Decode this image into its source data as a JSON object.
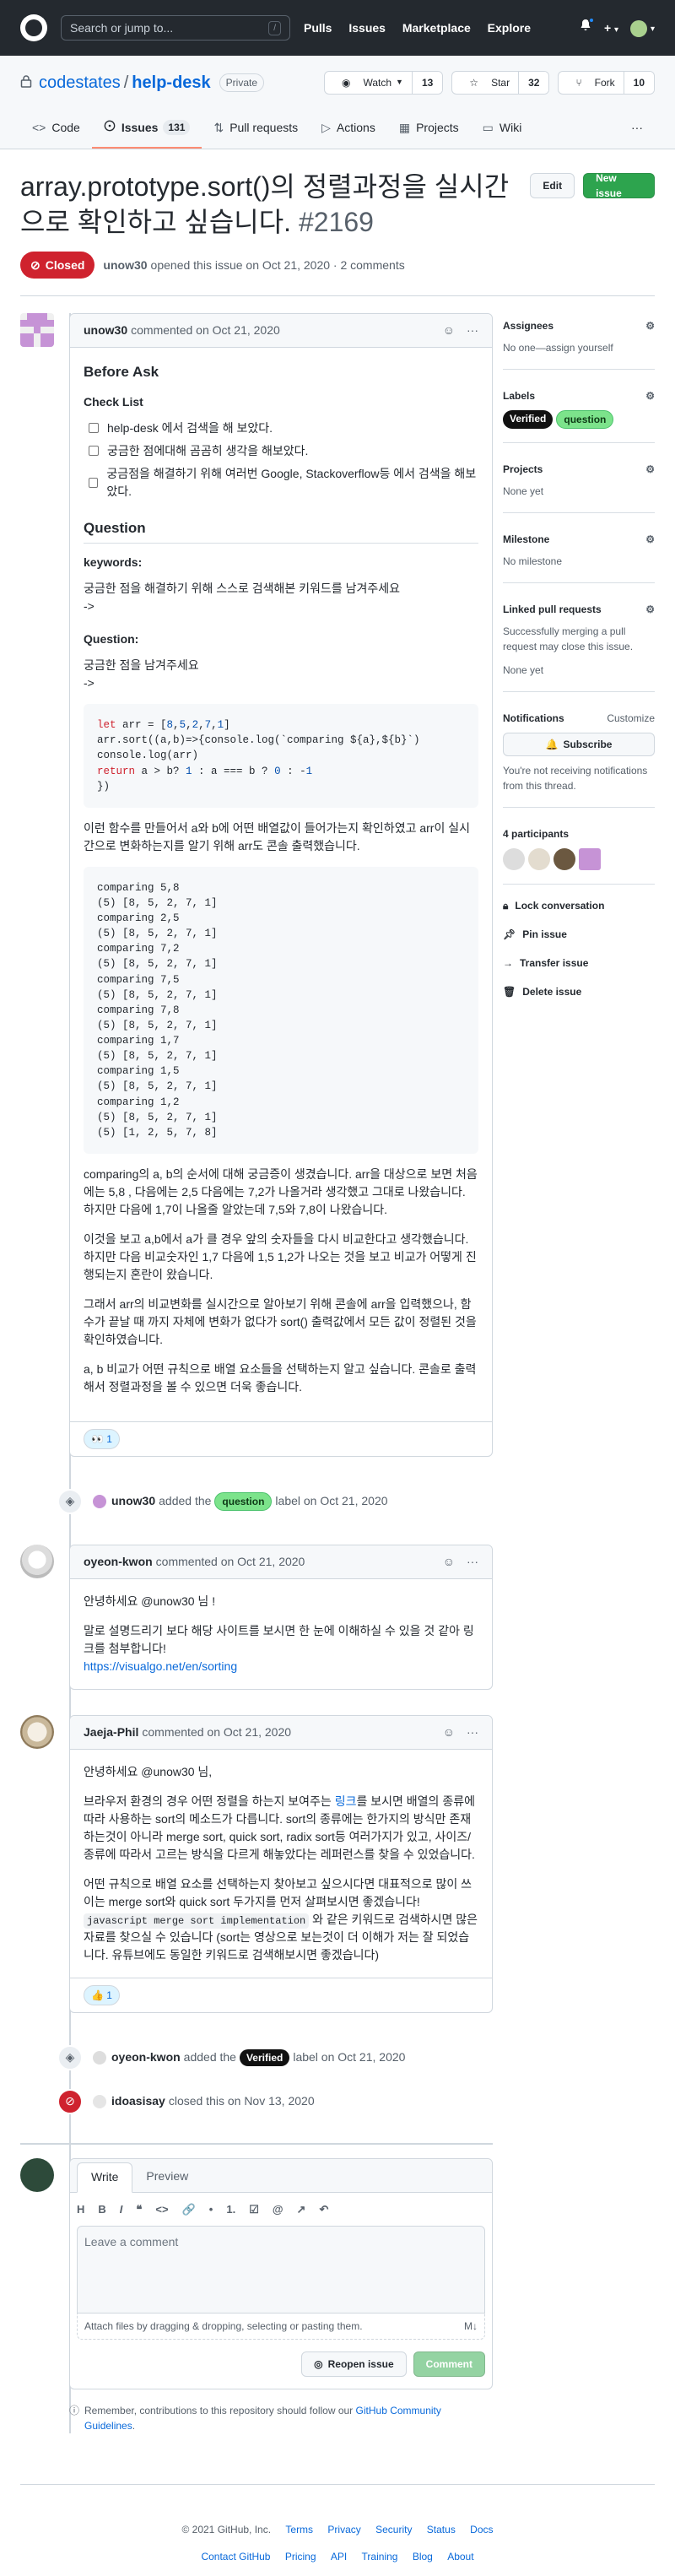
{
  "header": {
    "search_placeholder": "Search or jump to...",
    "search_key": "/",
    "nav": [
      "Pulls",
      "Issues",
      "Marketplace",
      "Explore"
    ],
    "plus": "+",
    "caret": "▾"
  },
  "repo": {
    "owner": "codestates",
    "sep": "/",
    "name": "help-desk",
    "visibility": "Private",
    "watch_label": "Watch",
    "watch_count": "13",
    "star_label": "Star",
    "star_count": "32",
    "fork_label": "Fork",
    "fork_count": "10",
    "tabs": [
      {
        "label": "Code",
        "icon": "code-icon"
      },
      {
        "label": "Issues",
        "count": "131",
        "icon": "issue-icon"
      },
      {
        "label": "Pull requests",
        "icon": "pr-icon"
      },
      {
        "label": "Actions",
        "icon": "play-icon"
      },
      {
        "label": "Projects",
        "icon": "project-icon"
      },
      {
        "label": "Wiki",
        "icon": "book-icon"
      }
    ],
    "more": "···"
  },
  "issue": {
    "title": "array.prototype.sort()의 정렬과정을 실시간으로 확인하고 싶습니다.",
    "number": "#2169",
    "edit_label": "Edit",
    "new_label": "New issue",
    "state": "Closed",
    "author": "unow30",
    "meta_text": "opened this issue on Oct 21, 2020 · 2 comments"
  },
  "comments": [
    {
      "author": "unow30",
      "date": "commented on Oct 21, 2020",
      "before_ask": "Before Ask",
      "checklist_title": "Check List",
      "checklist": [
        "help-desk 에서 검색을 해 보았다.",
        "궁금한 점에대해 곰곰히 생각을 해보았다.",
        "궁금점을 해결하기 위해 여러번 Google, Stackoverflow등 에서 검색을 해보았다."
      ],
      "question_h": "Question",
      "keywords_h": "keywords:",
      "keywords_text": "궁금한 점을 해결하기 위해 스스로 검색해본 키워드를 남겨주세요",
      "arrow1": "->",
      "question_h2": "Question:",
      "question_text": "궁금한 점을 남겨주세요",
      "arrow2": "->",
      "code1": [
        "let arr = [8,5,2,7,1]",
        "arr.sort((a,b)=>{console.log(`comparing ${a},${b}`)",
        "console.log(arr)",
        "return a > b? 1 : a === b ? 0 : -1",
        "})"
      ],
      "p1": "이런 함수를 만들어서 a와 b에 어떤 배열값이 들어가는지 확인하였고 arr이 실시간으로 변화하는지를 알기 위해 arr도 콘솔 출력했습니다.",
      "code2": "comparing 5,8\n(5) [8, 5, 2, 7, 1]\ncomparing 2,5\n(5) [8, 5, 2, 7, 1]\ncomparing 7,2\n(5) [8, 5, 2, 7, 1]\ncomparing 7,5\n(5) [8, 5, 2, 7, 1]\ncomparing 7,8\n(5) [8, 5, 2, 7, 1]\ncomparing 1,7\n(5) [8, 5, 2, 7, 1]\ncomparing 1,5\n(5) [8, 5, 2, 7, 1]\ncomparing 1,2\n(5) [8, 5, 2, 7, 1]\n(5) [1, 2, 5, 7, 8]",
      "p2": "comparing의 a, b의 순서에 대해 궁금증이 생겼습니다. arr을 대상으로 보면 처음에는 5,8 , 다음에는 2,5 다음에는 7,2가 나올거라 생각했고 그대로 나왔습니다. 하지만 다음에 1,7이 나올줄 알았는데 7,5와 7,8이 나왔습니다.",
      "p3": "이것을 보고 a,b에서 a가 클 경우 앞의 숫자들을 다시 비교한다고 생각했습니다. 하지만 다음 비교숫자인 1,7 다음에 1,5 1,2가 나오는 것을 보고 비교가 어떻게 진행되는지 혼란이 왔습니다.",
      "p4": "그래서 arr의 비교변화를 실시간으로 알아보기 위해 콘솔에 arr을 입력했으나, 함수가 끝날 때 까지 자체에 변화가 없다가 sort() 출력값에서 모든 값이 정렬된 것을 확인하였습니다.",
      "p5": "a, b 비교가 어떤 규칙으로 배열 요소들을 선택하는지 알고 싶습니다. 콘솔로 출력해서 정렬과정을 볼 수 있으면 더욱 좋습니다.",
      "reaction": "👀 1"
    },
    {
      "author": "oyeon-kwon",
      "date": "commented on Oct 21, 2020",
      "greet": "안녕하세요 @unow30 님 !",
      "p1": "말로 설명드리기 보다 해당 사이트를 보시면 한 눈에 이해하실 수 있을 것 같아 링크를 첨부합니다!",
      "link": "https://visualgo.net/en/sorting"
    },
    {
      "author": "Jaeja-Phil",
      "date": "commented on Oct 21, 2020",
      "greet": "안녕하세요 @unow30 님,",
      "p1a": "브라우저 환경의 경우 어떤 정렬을 하는지 보여주는 ",
      "p1link": "링크",
      "p1b": "를 보시면 배열의 종류에 따라 사용하는 sort의 메소드가 다릅니다. sort의 종류에는 한가지의 방식만 존재하는것이 아니라 merge sort, quick sort, radix sort등 여러가지가 있고, 사이즈/종류에 따라서 고르는 방식을 다르게 해놓았다는 레퍼런스를 찾을 수 있었습니다.",
      "p2a": "어떤 규칙으로 배열 요소를 선택하는지 찾아보고 싶으시다면 대표적으로 많이 쓰이는 merge sort와 quick sort 두가지를 먼저 살펴보시면 좋겠습니다! ",
      "p2code": "javascript merge sort implementation",
      "p2b": " 와 같은 키워드로 검색하시면 많은 자료를 찾으실 수 있습니다 (sort는 영상으로 보는것이 더 이해가 저는 잘 되었습니다. 유튜브에도 동일한 키워드로 검색해보시면 좋겠습니다)",
      "reaction": "👍 1"
    }
  ],
  "events": {
    "label1_user": "unow30",
    "label1_pre": "added the",
    "label1_name": "question",
    "label1_post": "label on Oct 21, 2020",
    "label2_user": "oyeon-kwon",
    "label2_pre": "added the",
    "label2_name": "Verified",
    "label2_post": "label on Oct 21, 2020",
    "close_user": "idoasisay",
    "close_text": "closed this on Nov 13, 2020"
  },
  "sidebar": {
    "assignees_h": "Assignees",
    "assignees_v": "No one—assign yourself",
    "labels_h": "Labels",
    "labels": [
      "Verified",
      "question"
    ],
    "projects_h": "Projects",
    "projects_v": "None yet",
    "milestone_h": "Milestone",
    "milestone_v": "No milestone",
    "linked_h": "Linked pull requests",
    "linked_desc": "Successfully merging a pull request may close this issue.",
    "linked_v": "None yet",
    "notif_h": "Notifications",
    "notif_custom": "Customize",
    "subscribe": "Subscribe",
    "notif_desc": "You're not receiving notifications from this thread.",
    "participants": "4 participants",
    "lock": "Lock conversation",
    "pin": "Pin issue",
    "transfer": "Transfer issue",
    "delete": "Delete issue"
  },
  "composer": {
    "tab_write": "Write",
    "tab_preview": "Preview",
    "tools": [
      "H",
      "B",
      "I",
      "❝",
      "<>",
      "🔗",
      "•",
      "1.",
      "☑",
      "@",
      "↗",
      "↶"
    ],
    "placeholder": "Leave a comment",
    "attach": "Attach files by dragging & dropping, selecting or pasting them.",
    "md": "M↓",
    "reopen": "Reopen issue",
    "comment": "Comment",
    "remind_pre": "Remember, contributions to this repository should follow our ",
    "remind_link": "GitHub Community Guidelines",
    "remind_post": "."
  },
  "footer": {
    "copyright": "© 2021 GitHub, Inc.",
    "row1": [
      "Terms",
      "Privacy",
      "Security",
      "Status",
      "Docs"
    ],
    "row2": [
      "Contact GitHub",
      "Pricing",
      "API",
      "Training",
      "Blog",
      "About"
    ]
  },
  "colors": {
    "accent": "#0969da",
    "closed": "#cf222e",
    "green": "#2da44e",
    "label_question": "#7ce38b",
    "label_verified": "#111111"
  }
}
